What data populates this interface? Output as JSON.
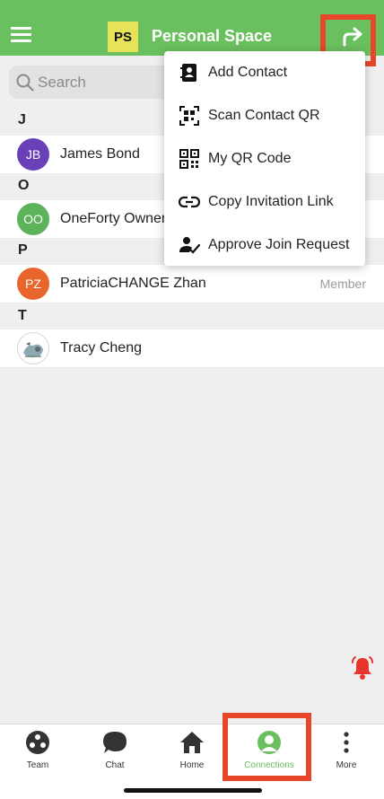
{
  "header": {
    "space_badge": "PS",
    "title": "Personal Space",
    "colors": {
      "bar": "#6abf5e",
      "badge": "#e6e25a",
      "highlight": "#e8462b"
    }
  },
  "search": {
    "placeholder": "Search"
  },
  "contacts": [
    {
      "section": "J",
      "initials": "JB",
      "name": "James Bond",
      "role": "",
      "avatar_color": "#6a40b8"
    },
    {
      "section": "O",
      "initials": "OO",
      "name": "OneForty Owner",
      "role": "",
      "avatar_color": "#5cb35a"
    },
    {
      "section": "P",
      "initials": "PZ",
      "name": "PatriciaCHANGE Zhan",
      "role": "Member",
      "avatar_color": "#e8652b"
    },
    {
      "section": "T",
      "initials": "",
      "name": "Tracy Cheng",
      "role": "",
      "avatar_color": "#ffffff"
    }
  ],
  "menu": {
    "items": [
      {
        "label": "Add Contact",
        "icon": "contact-book-icon"
      },
      {
        "label": "Scan Contact QR",
        "icon": "qr-scan-icon"
      },
      {
        "label": "My QR Code",
        "icon": "qr-code-icon"
      },
      {
        "label": "Copy Invitation Link",
        "icon": "link-icon"
      },
      {
        "label": "Approve Join Request",
        "icon": "user-check-icon"
      }
    ]
  },
  "tabs": [
    {
      "label": "Team",
      "icon": "team-icon"
    },
    {
      "label": "Chat",
      "icon": "chat-icon"
    },
    {
      "label": "Home",
      "icon": "home-icon"
    },
    {
      "label": "Connections",
      "icon": "connections-icon",
      "active": true
    },
    {
      "label": "More",
      "icon": "more-icon"
    }
  ]
}
